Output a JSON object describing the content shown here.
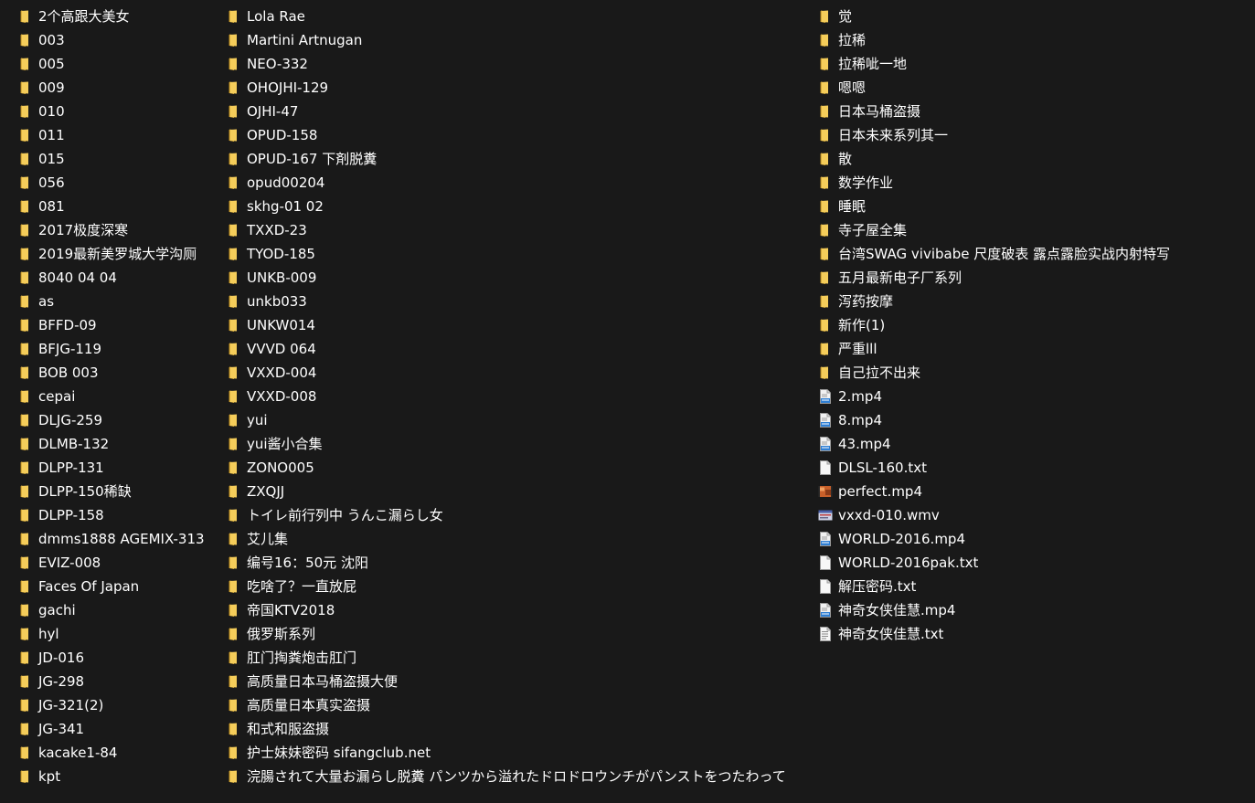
{
  "columns": [
    {
      "items": [
        {
          "name": "2个高跟大美女",
          "type": "folder"
        },
        {
          "name": "003",
          "type": "folder"
        },
        {
          "name": "005",
          "type": "folder"
        },
        {
          "name": "009",
          "type": "folder"
        },
        {
          "name": "010",
          "type": "folder"
        },
        {
          "name": "011",
          "type": "folder"
        },
        {
          "name": "015",
          "type": "folder"
        },
        {
          "name": "056",
          "type": "folder"
        },
        {
          "name": "081",
          "type": "folder"
        },
        {
          "name": "2017极度深寒",
          "type": "folder"
        },
        {
          "name": "2019最新美罗城大学沟厕",
          "type": "folder"
        },
        {
          "name": "8040 04 04",
          "type": "folder"
        },
        {
          "name": "as",
          "type": "folder"
        },
        {
          "name": "BFFD-09",
          "type": "folder"
        },
        {
          "name": "BFJG-119",
          "type": "folder"
        },
        {
          "name": "BOB 003",
          "type": "folder"
        },
        {
          "name": "cepai",
          "type": "folder"
        },
        {
          "name": "DLJG-259",
          "type": "folder"
        },
        {
          "name": "DLMB-132",
          "type": "folder"
        },
        {
          "name": "DLPP-131",
          "type": "folder"
        },
        {
          "name": "DLPP-150稀缺",
          "type": "folder"
        },
        {
          "name": "DLPP-158",
          "type": "folder"
        },
        {
          "name": "dmms1888  AGEMIX-313",
          "type": "folder"
        },
        {
          "name": "EVIZ-008",
          "type": "folder"
        },
        {
          "name": "Faces Of Japan",
          "type": "folder"
        },
        {
          "name": "gachi",
          "type": "folder"
        },
        {
          "name": "hyl",
          "type": "folder"
        },
        {
          "name": "JD-016",
          "type": "folder"
        },
        {
          "name": "JG-298",
          "type": "folder"
        },
        {
          "name": "JG-321(2)",
          "type": "folder"
        },
        {
          "name": "JG-341",
          "type": "folder"
        },
        {
          "name": "kacake1-84",
          "type": "folder"
        },
        {
          "name": "kpt",
          "type": "folder"
        }
      ]
    },
    {
      "items": [
        {
          "name": "Lola Rae",
          "type": "folder"
        },
        {
          "name": "Martini Artnugan",
          "type": "folder"
        },
        {
          "name": "NEO-332",
          "type": "folder"
        },
        {
          "name": "OHOJHI-129",
          "type": "folder"
        },
        {
          "name": "OJHI-47",
          "type": "folder"
        },
        {
          "name": "OPUD-158",
          "type": "folder"
        },
        {
          "name": "OPUD-167 下剤脱糞",
          "type": "folder"
        },
        {
          "name": "opud00204",
          "type": "folder"
        },
        {
          "name": "skhg-01  02",
          "type": "folder"
        },
        {
          "name": "TXXD-23",
          "type": "folder"
        },
        {
          "name": "TYOD-185",
          "type": "folder"
        },
        {
          "name": "UNKB-009",
          "type": "folder"
        },
        {
          "name": "unkb033",
          "type": "folder"
        },
        {
          "name": "UNKW014",
          "type": "folder"
        },
        {
          "name": "VVVD 064",
          "type": "folder"
        },
        {
          "name": "VXXD-004",
          "type": "folder"
        },
        {
          "name": "VXXD-008",
          "type": "folder"
        },
        {
          "name": "yui",
          "type": "folder"
        },
        {
          "name": "yui酱小合集",
          "type": "folder"
        },
        {
          "name": "ZONO005",
          "type": "folder"
        },
        {
          "name": "ZXQJJ",
          "type": "folder"
        },
        {
          "name": "トイレ前行列中 うんこ漏らし女",
          "type": "folder"
        },
        {
          "name": "艾儿集",
          "type": "folder"
        },
        {
          "name": "编号16：50元 沈阳",
          "type": "folder"
        },
        {
          "name": "吃啥了？一直放屁",
          "type": "folder"
        },
        {
          "name": "帝国KTV2018",
          "type": "folder"
        },
        {
          "name": "俄罗斯系列",
          "type": "folder"
        },
        {
          "name": "肛门掏粪炮击肛门",
          "type": "folder"
        },
        {
          "name": "高质量日本马桶盗摄大便",
          "type": "folder"
        },
        {
          "name": "高质量日本真实盗摄",
          "type": "folder"
        },
        {
          "name": "和式和服盗摄",
          "type": "folder"
        },
        {
          "name": "护士妹妹密码  sifangclub.net",
          "type": "folder"
        },
        {
          "name": "浣腸されて大量お漏らし脱糞    パンツから溢れたドロドロウンチがパンストをつたわって",
          "type": "folder"
        }
      ]
    },
    {
      "items": [
        {
          "name": "觉",
          "type": "folder"
        },
        {
          "name": "拉稀",
          "type": "folder"
        },
        {
          "name": "拉稀呲一地",
          "type": "folder"
        },
        {
          "name": "嗯嗯",
          "type": "folder"
        },
        {
          "name": "日本马桶盗摄",
          "type": "folder"
        },
        {
          "name": "日本未来系列其一",
          "type": "folder"
        },
        {
          "name": "散",
          "type": "folder"
        },
        {
          "name": "数学作业",
          "type": "folder"
        },
        {
          "name": "睡眠",
          "type": "folder"
        },
        {
          "name": "寺子屋全集",
          "type": "folder"
        },
        {
          "name": "台湾SWAG vivibabe  尺度破表 露点露脸实战内射特写",
          "type": "folder"
        },
        {
          "name": "五月最新电子厂系列",
          "type": "folder"
        },
        {
          "name": "泻药按摩",
          "type": "folder"
        },
        {
          "name": "新作(1)",
          "type": "folder"
        },
        {
          "name": "严重lll",
          "type": "folder"
        },
        {
          "name": "自己拉不出来",
          "type": "folder"
        },
        {
          "name": "2.mp4",
          "type": "video"
        },
        {
          "name": "8.mp4",
          "type": "video"
        },
        {
          "name": "43.mp4",
          "type": "video"
        },
        {
          "name": "DLSL-160.txt",
          "type": "blank"
        },
        {
          "name": "perfect.mp4",
          "type": "thumb-orange"
        },
        {
          "name": "vxxd-010.wmv",
          "type": "thumb-wmv"
        },
        {
          "name": "WORLD-2016.mp4",
          "type": "video"
        },
        {
          "name": "WORLD-2016pak.txt",
          "type": "blank"
        },
        {
          "name": "解压密码.txt",
          "type": "blank"
        },
        {
          "name": "神奇女侠佳慧.mp4",
          "type": "video"
        },
        {
          "name": "神奇女侠佳慧.txt",
          "type": "text"
        }
      ]
    }
  ],
  "colors": {
    "background": "#191919",
    "text": "#ffffff",
    "folder_back": "#d8a730",
    "folder_front": "#f5cd5a",
    "video_blue": "#2f7fd4"
  }
}
